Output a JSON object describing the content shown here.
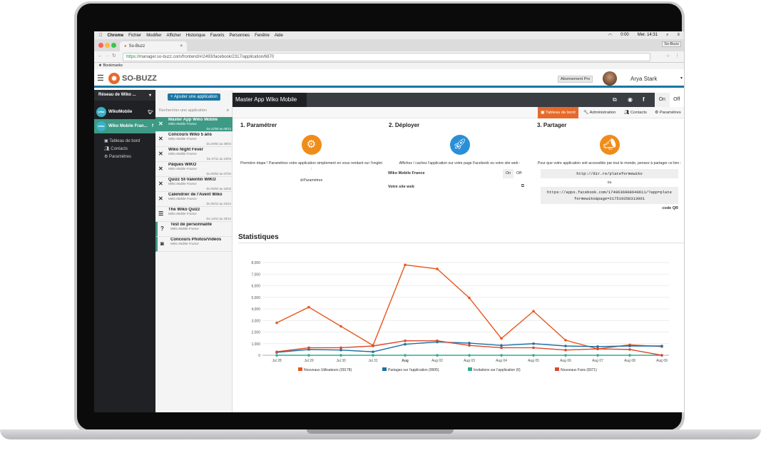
{
  "mac_menu": {
    "items": [
      "Chrome",
      "Fichier",
      "Modifier",
      "Afficher",
      "Historique",
      "Favoris",
      "Personnes",
      "Fenêtre",
      "Aide"
    ],
    "clock": "Mer. 14:31",
    "battery": "0:00"
  },
  "browser": {
    "tab_title": "So-Buzz",
    "url_secure": "https://",
    "url": "manager.so-buzz.com/frontend/#/2493/facebook/2317/application/6870",
    "bookmarks": "Bookmarks",
    "profile": "So-Buzz"
  },
  "header": {
    "logo": "SO-BUZZ",
    "plan": "Abonnement Pro",
    "user": "Arya Stark"
  },
  "sidebar": {
    "network": "Réseau de Wiko ...",
    "accounts": [
      {
        "name": "WikoMobile",
        "network": "twitter"
      },
      {
        "name": "Wiko Mobile Fran...",
        "network": "facebook"
      }
    ],
    "submenu": [
      "Tableau de bord",
      "Contacts",
      "Paramètres"
    ]
  },
  "applist": {
    "add_label": "+ Ajouter une application",
    "search_placeholder": "Rechercher une application",
    "items": [
      {
        "title": "Master App Wiko Mobile",
        "sub": "Wiko Mobile France",
        "date": "Du 22/08 au 05/12",
        "icon": "✕"
      },
      {
        "title": "Concours Wiko 5 ans",
        "sub": "Wiko Mobile France",
        "date": "Du 26/02 au 26/04",
        "icon": "✕"
      },
      {
        "title": "Wiko Night Fever",
        "sub": "Wiko Mobile France",
        "date": "Du 27/11 au 24/04",
        "icon": "✕"
      },
      {
        "title": "Pâques WIKO",
        "sub": "Wiko Mobile France",
        "date": "Du 08/02 au 07/04",
        "icon": "✕"
      },
      {
        "title": "Quizz St-Valentin WIKO",
        "sub": "Wiko Mobile France",
        "date": "Du 05/02 au 15/02",
        "icon": "✕"
      },
      {
        "title": "Calendrier de l'Avent Wiko",
        "sub": "Wiko Mobile France",
        "date": "Du 05/12 au 24/12",
        "icon": "✕"
      },
      {
        "title": "The Wiko Quizz",
        "sub": "Wiko Mobile France",
        "date": "Du 13/12 au 20/12",
        "icon": "☰"
      },
      {
        "title": "Test de personnalité",
        "sub": "Wiko Mobile France",
        "date": "",
        "icon": "?"
      },
      {
        "title": "Concours Photos/Vidéos",
        "sub": "Wiko Mobile France",
        "date": "",
        "icon": "◙"
      }
    ]
  },
  "main": {
    "title": "Master App Wiko Mobile",
    "on": "On",
    "off": "Off",
    "nav": [
      "Tableau de bord",
      "Administration",
      "Contacts",
      "Paramètres"
    ],
    "step1": {
      "title": "1. Paramétrer",
      "text": "Première étape ! Paramétrez votre application simplement en vous rendant sur l'onglet :",
      "link": "Paramètres"
    },
    "step2": {
      "title": "2. Déployer",
      "text": "Affichez / cachez l'application sur votre page Facebook ou votre site web :",
      "page": "Wiko Mobile France",
      "site": "Votre site web",
      "on": "On",
      "off": "Off"
    },
    "step3": {
      "title": "3. Partager",
      "text": "Pour que votre application soit accessible par tout le monde, pensez à partager ce lien :",
      "short": "http://dir.re/plateformewiko",
      "or": "ou",
      "long1": "https://apps.facebook.com/1749636908640611/?app=plate",
      "long2": "formewiko&page=217519358313001",
      "qr": "code QR"
    },
    "stats_title": "Statistiques"
  },
  "chart_data": {
    "type": "line",
    "categories": [
      "Jul 28",
      "Jul 29",
      "Jul 30",
      "Jul 31",
      "Aug",
      "Aug 02",
      "Aug 03",
      "Aug 04",
      "Aug 05",
      "Aug 06",
      "Aug 07",
      "Aug 08",
      "Aug 09"
    ],
    "ylim": [
      0,
      8000
    ],
    "yticks": [
      "0",
      "1,000",
      "2,000",
      "3,000",
      "4,000",
      "5,000",
      "6,000",
      "7,000",
      "8,000"
    ],
    "series": [
      {
        "name": "Nouveaux Utilisateurs (39178)",
        "color": "#e6581e",
        "values": [
          2800,
          4150,
          2500,
          850,
          7800,
          7450,
          4950,
          1450,
          3800,
          1300,
          550,
          900,
          750
        ]
      },
      {
        "name": "Partages sur l'application (9905)",
        "color": "#1d6fa5",
        "values": [
          250,
          500,
          450,
          300,
          950,
          1150,
          1050,
          850,
          1000,
          800,
          750,
          800,
          800
        ]
      },
      {
        "name": "Invitations sur l'application (0)",
        "color": "#2fae8f",
        "values": [
          0,
          0,
          0,
          0,
          0,
          0,
          0,
          0,
          0,
          0,
          0,
          0,
          0
        ]
      },
      {
        "name": "Nouveaux Fans (8371)",
        "color": "#d94a2e",
        "values": [
          300,
          650,
          650,
          800,
          1250,
          1250,
          850,
          650,
          650,
          450,
          550,
          500,
          0
        ]
      }
    ]
  }
}
